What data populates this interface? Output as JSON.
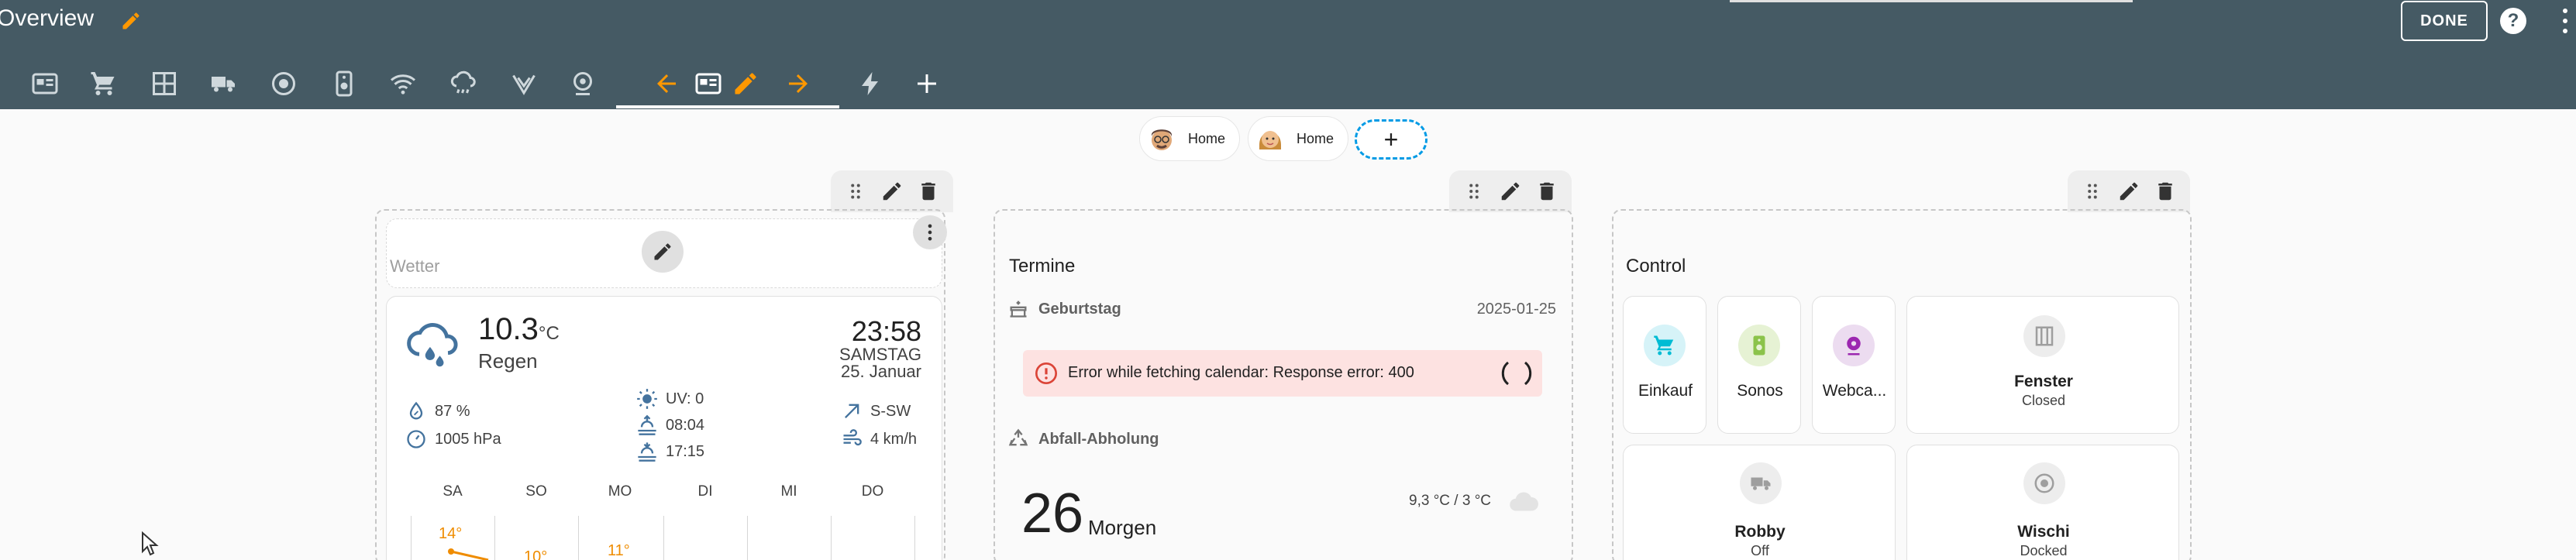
{
  "header": {
    "title": "Overview",
    "done_label": "DONE",
    "help_label": "?",
    "tabs": [
      {
        "icon": "card-icon"
      },
      {
        "icon": "cart-icon"
      },
      {
        "icon": "window-grid-icon"
      },
      {
        "icon": "truck-icon"
      },
      {
        "icon": "robot-vacuum-icon"
      },
      {
        "icon": "speaker-icon"
      },
      {
        "icon": "wifi-icon"
      },
      {
        "icon": "weather-rain-icon"
      },
      {
        "icon": "antenna-icon"
      },
      {
        "icon": "webcam-icon"
      },
      {
        "icon": "arrow-left-icon",
        "color": "#ff9800"
      },
      {
        "icon": "card-icon"
      },
      {
        "icon": "pencil-icon",
        "color": "#ff9800"
      },
      {
        "icon": "arrow-right-icon",
        "color": "#ff9800"
      },
      {
        "icon": "lightning-icon"
      },
      {
        "icon": "plus-icon"
      }
    ]
  },
  "sections": {
    "chips": [
      {
        "label": "Home",
        "avatar": "man-avatar"
      },
      {
        "label": "Home",
        "avatar": "woman-avatar"
      }
    ],
    "add_label": "+"
  },
  "weather_card": {
    "placeholder_title": "Wetter",
    "temperature": "10.3",
    "unit": "°C",
    "condition": "Regen",
    "time": "23:58",
    "weekday": "SAMSTAG",
    "date": "25. Januar",
    "humidity": "87 %",
    "pressure": "1005 hPa",
    "uv": "UV: 0",
    "sunrise": "08:04",
    "sunset": "17:15",
    "wind_direction": "S-SW",
    "wind_speed": "4 km/h",
    "forecast_days": [
      "SA",
      "SO",
      "MO",
      "DI",
      "MI",
      "DO"
    ],
    "forecast_highs": [
      "14°",
      "10°",
      "11°"
    ]
  },
  "calendar_card": {
    "title": "Termine",
    "birthday_label": "Geburtstag",
    "birthday_date": "2025-01-25",
    "error": "Error while fetching calendar: Response error: 400",
    "waste_label": "Abfall-Abholung",
    "day_number": "26",
    "day_word": "Morgen",
    "forecast": "9,3 °C / 3 °C"
  },
  "control_card": {
    "title": "Control",
    "tiles": [
      {
        "name": "Einkauf",
        "icon": "cart-icon",
        "color": "#00bcd4"
      },
      {
        "name": "Sonos",
        "icon": "speaker-icon",
        "color": "#8bc34a"
      },
      {
        "name": "Webca...",
        "icon": "webcam-icon",
        "color": "#9c27b0"
      },
      {
        "name": "Fenster",
        "state": "Closed",
        "icon": "window-icon"
      },
      {
        "name": "Robby",
        "state": "Off",
        "icon": "truck-icon"
      },
      {
        "name": "Wischi",
        "state": "Docked",
        "icon": "robot-vacuum-icon"
      }
    ]
  },
  "colors": {
    "header": "#455a64",
    "accent": "#ff9800",
    "error_bg": "#fde2e1",
    "error_fg": "#db4437",
    "dashed_add": "#039be5"
  }
}
